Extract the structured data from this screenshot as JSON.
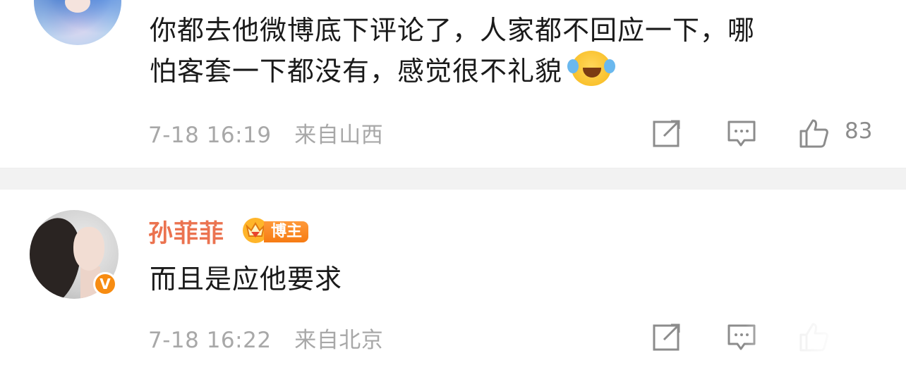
{
  "comments": [
    {
      "text_line1": "你都去他微博底下评论了，人家都不回应一下，哪",
      "text_line2": "怕客套一下都没有，感觉很不礼貌",
      "emoji": "laugh-cry-emoji",
      "time": "7-18 16:19",
      "location": "来自山西",
      "like_count": "83"
    },
    {
      "username": "孙菲菲",
      "badge_label": "博主",
      "verified_badge": "V",
      "text": "而且是应他要求",
      "time": "7-18 16:22",
      "location": "来自北京"
    }
  ],
  "colors": {
    "username": "#eb7350",
    "meta": "#a8a8a8",
    "badge": "#f78c12",
    "divider": "#f2f2f2"
  }
}
